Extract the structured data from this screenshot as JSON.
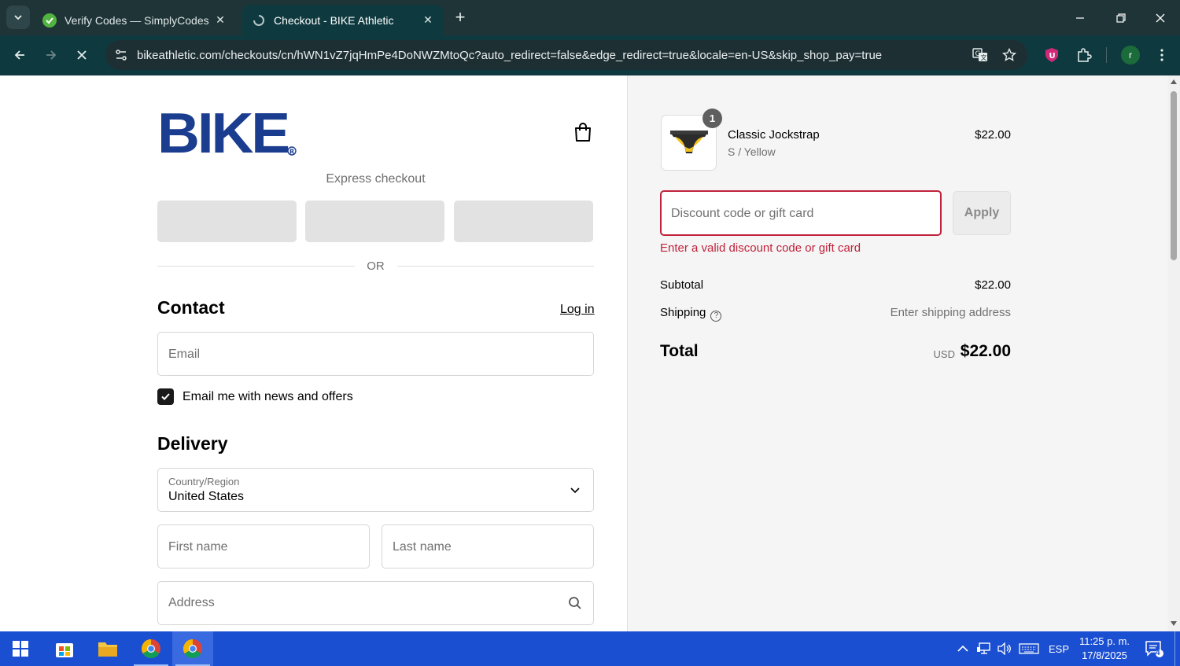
{
  "browser": {
    "tabs": [
      {
        "title": "Verify Codes — SimplyCodes",
        "active": false
      },
      {
        "title": "Checkout - BIKE Athletic",
        "active": true
      }
    ],
    "url": "bikeathletic.com/checkouts/cn/hWN1vZ7jqHmPe4DoNWZMtoQc?auto_redirect=false&edge_redirect=true&locale=en-US&skip_shop_pay=true",
    "profile_initial": "r",
    "extension_badge": "U"
  },
  "checkout": {
    "logo_text": "BIKE",
    "express_label": "Express checkout",
    "or_label": "OR",
    "contact": {
      "heading": "Contact",
      "login_label": "Log in",
      "email_placeholder": "Email",
      "newsletter_label": "Email me with news and offers",
      "newsletter_checked": true
    },
    "delivery": {
      "heading": "Delivery",
      "country_label": "Country/Region",
      "country_value": "United States",
      "first_name_placeholder": "First name",
      "last_name_placeholder": "Last name",
      "address_placeholder": "Address"
    }
  },
  "summary": {
    "product": {
      "name": "Classic Jockstrap",
      "variant": "S / Yellow",
      "price": "$22.00",
      "quantity": "1"
    },
    "discount_placeholder": "Discount code or gift card",
    "apply_label": "Apply",
    "discount_error": "Enter a valid discount code or gift card",
    "subtotal_label": "Subtotal",
    "subtotal_value": "$22.00",
    "shipping_label": "Shipping",
    "shipping_value": "Enter shipping address",
    "total_label": "Total",
    "total_currency": "USD",
    "total_value": "$22.00"
  },
  "taskbar": {
    "time": "11:25 p. m.",
    "date": "17/8/2025",
    "language": "ESP",
    "notification_count": "4"
  },
  "colors": {
    "brand_blue": "#1b3d8f",
    "error_red": "#c0223b",
    "chrome_dark": "#0e3a3f",
    "taskbar_blue": "#1b4fd1"
  }
}
